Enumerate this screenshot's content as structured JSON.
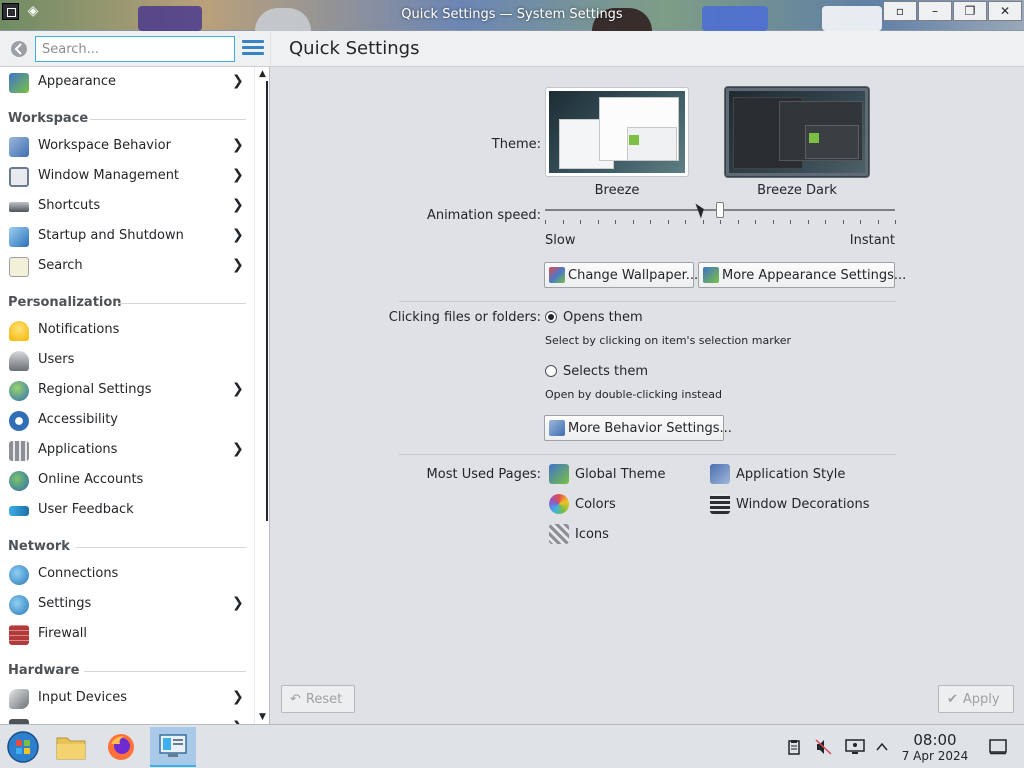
{
  "window": {
    "title": "Quick Settings — System Settings",
    "buttons": {
      "keep_above": "▫",
      "minimize": "–",
      "maximize": "❐",
      "close": "✕"
    }
  },
  "sidebar": {
    "search_placeholder": "Search...",
    "items": [
      {
        "label": "Appearance",
        "chevron": true,
        "icon": "appearance-icon",
        "color": "#3f74c9"
      },
      {
        "label": "Workspace Behavior",
        "chevron": true,
        "icon": "workspace-behavior-icon",
        "color": "#5b86c8"
      },
      {
        "label": "Window Management",
        "chevron": true,
        "icon": "window-management-icon",
        "color": "#6b7b8f"
      },
      {
        "label": "Shortcuts",
        "chevron": true,
        "icon": "keyboard-icon",
        "color": "#4e5358"
      },
      {
        "label": "Startup and Shutdown",
        "chevron": true,
        "icon": "startup-icon",
        "color": "#4c8fd1"
      },
      {
        "label": "Search",
        "chevron": true,
        "icon": "search-icon",
        "color": "#6aa0c8"
      },
      {
        "label": "Notifications",
        "chevron": false,
        "icon": "bell-icon",
        "color": "#f5c325"
      },
      {
        "label": "Users",
        "chevron": false,
        "icon": "users-icon",
        "color": "#6b6f74"
      },
      {
        "label": "Regional Settings",
        "chevron": true,
        "icon": "globe-icon",
        "color": "#4b8bd1"
      },
      {
        "label": "Accessibility",
        "chevron": false,
        "icon": "accessibility-icon",
        "color": "#2f6db5"
      },
      {
        "label": "Applications",
        "chevron": true,
        "icon": "applications-icon",
        "color": "#8c9096"
      },
      {
        "label": "Online Accounts",
        "chevron": false,
        "icon": "online-accounts-icon",
        "color": "#4a9c5a"
      },
      {
        "label": "User Feedback",
        "chevron": false,
        "icon": "feedback-icon",
        "color": "#3daee9"
      },
      {
        "label": "Connections",
        "chevron": false,
        "icon": "connections-icon",
        "color": "#3a8ac4"
      },
      {
        "label": "Settings",
        "chevron": true,
        "icon": "network-settings-icon",
        "color": "#3a8ac4"
      },
      {
        "label": "Firewall",
        "chevron": false,
        "icon": "firewall-icon",
        "color": "#b33a3a"
      },
      {
        "label": "Input Devices",
        "chevron": true,
        "icon": "mouse-icon",
        "color": "#6b6f74"
      }
    ],
    "headers": {
      "workspace": "Workspace",
      "personalization": "Personalization",
      "network": "Network",
      "hardware": "Hardware"
    }
  },
  "main": {
    "page_title": "Quick Settings",
    "theme_label": "Theme:",
    "themes": [
      {
        "name": "Breeze"
      },
      {
        "name": "Breeze Dark"
      }
    ],
    "animation_label": "Animation speed:",
    "slider_min": "Slow",
    "slider_max": "Instant",
    "slider_value": 0.5,
    "change_wallpaper": "Change Wallpaper...",
    "more_appearance": "More Appearance Settings...",
    "clicking_label": "Clicking files or folders:",
    "opens_them": "Opens them",
    "opens_sub": "Select by clicking on item's selection marker",
    "selects_them": "Selects them",
    "selects_sub": "Open by double-clicking instead",
    "more_behavior": "More Behavior Settings...",
    "most_used_label": "Most Used Pages:",
    "most_used": [
      {
        "label": "Global Theme",
        "icon": "global-theme-icon"
      },
      {
        "label": "Application Style",
        "icon": "application-style-icon"
      },
      {
        "label": "Colors",
        "icon": "colors-icon"
      },
      {
        "label": "Window Decorations",
        "icon": "window-decorations-icon"
      },
      {
        "label": "Icons",
        "icon": "icons-icon"
      }
    ],
    "reset": "Reset",
    "apply": "Apply"
  },
  "taskbar": {
    "time": "08:00",
    "date": "7 Apr 2024"
  },
  "colors": {
    "accent": "#3daee9",
    "sidebar_bg": "#ffffff",
    "main_bg": "#dfe1e4"
  }
}
